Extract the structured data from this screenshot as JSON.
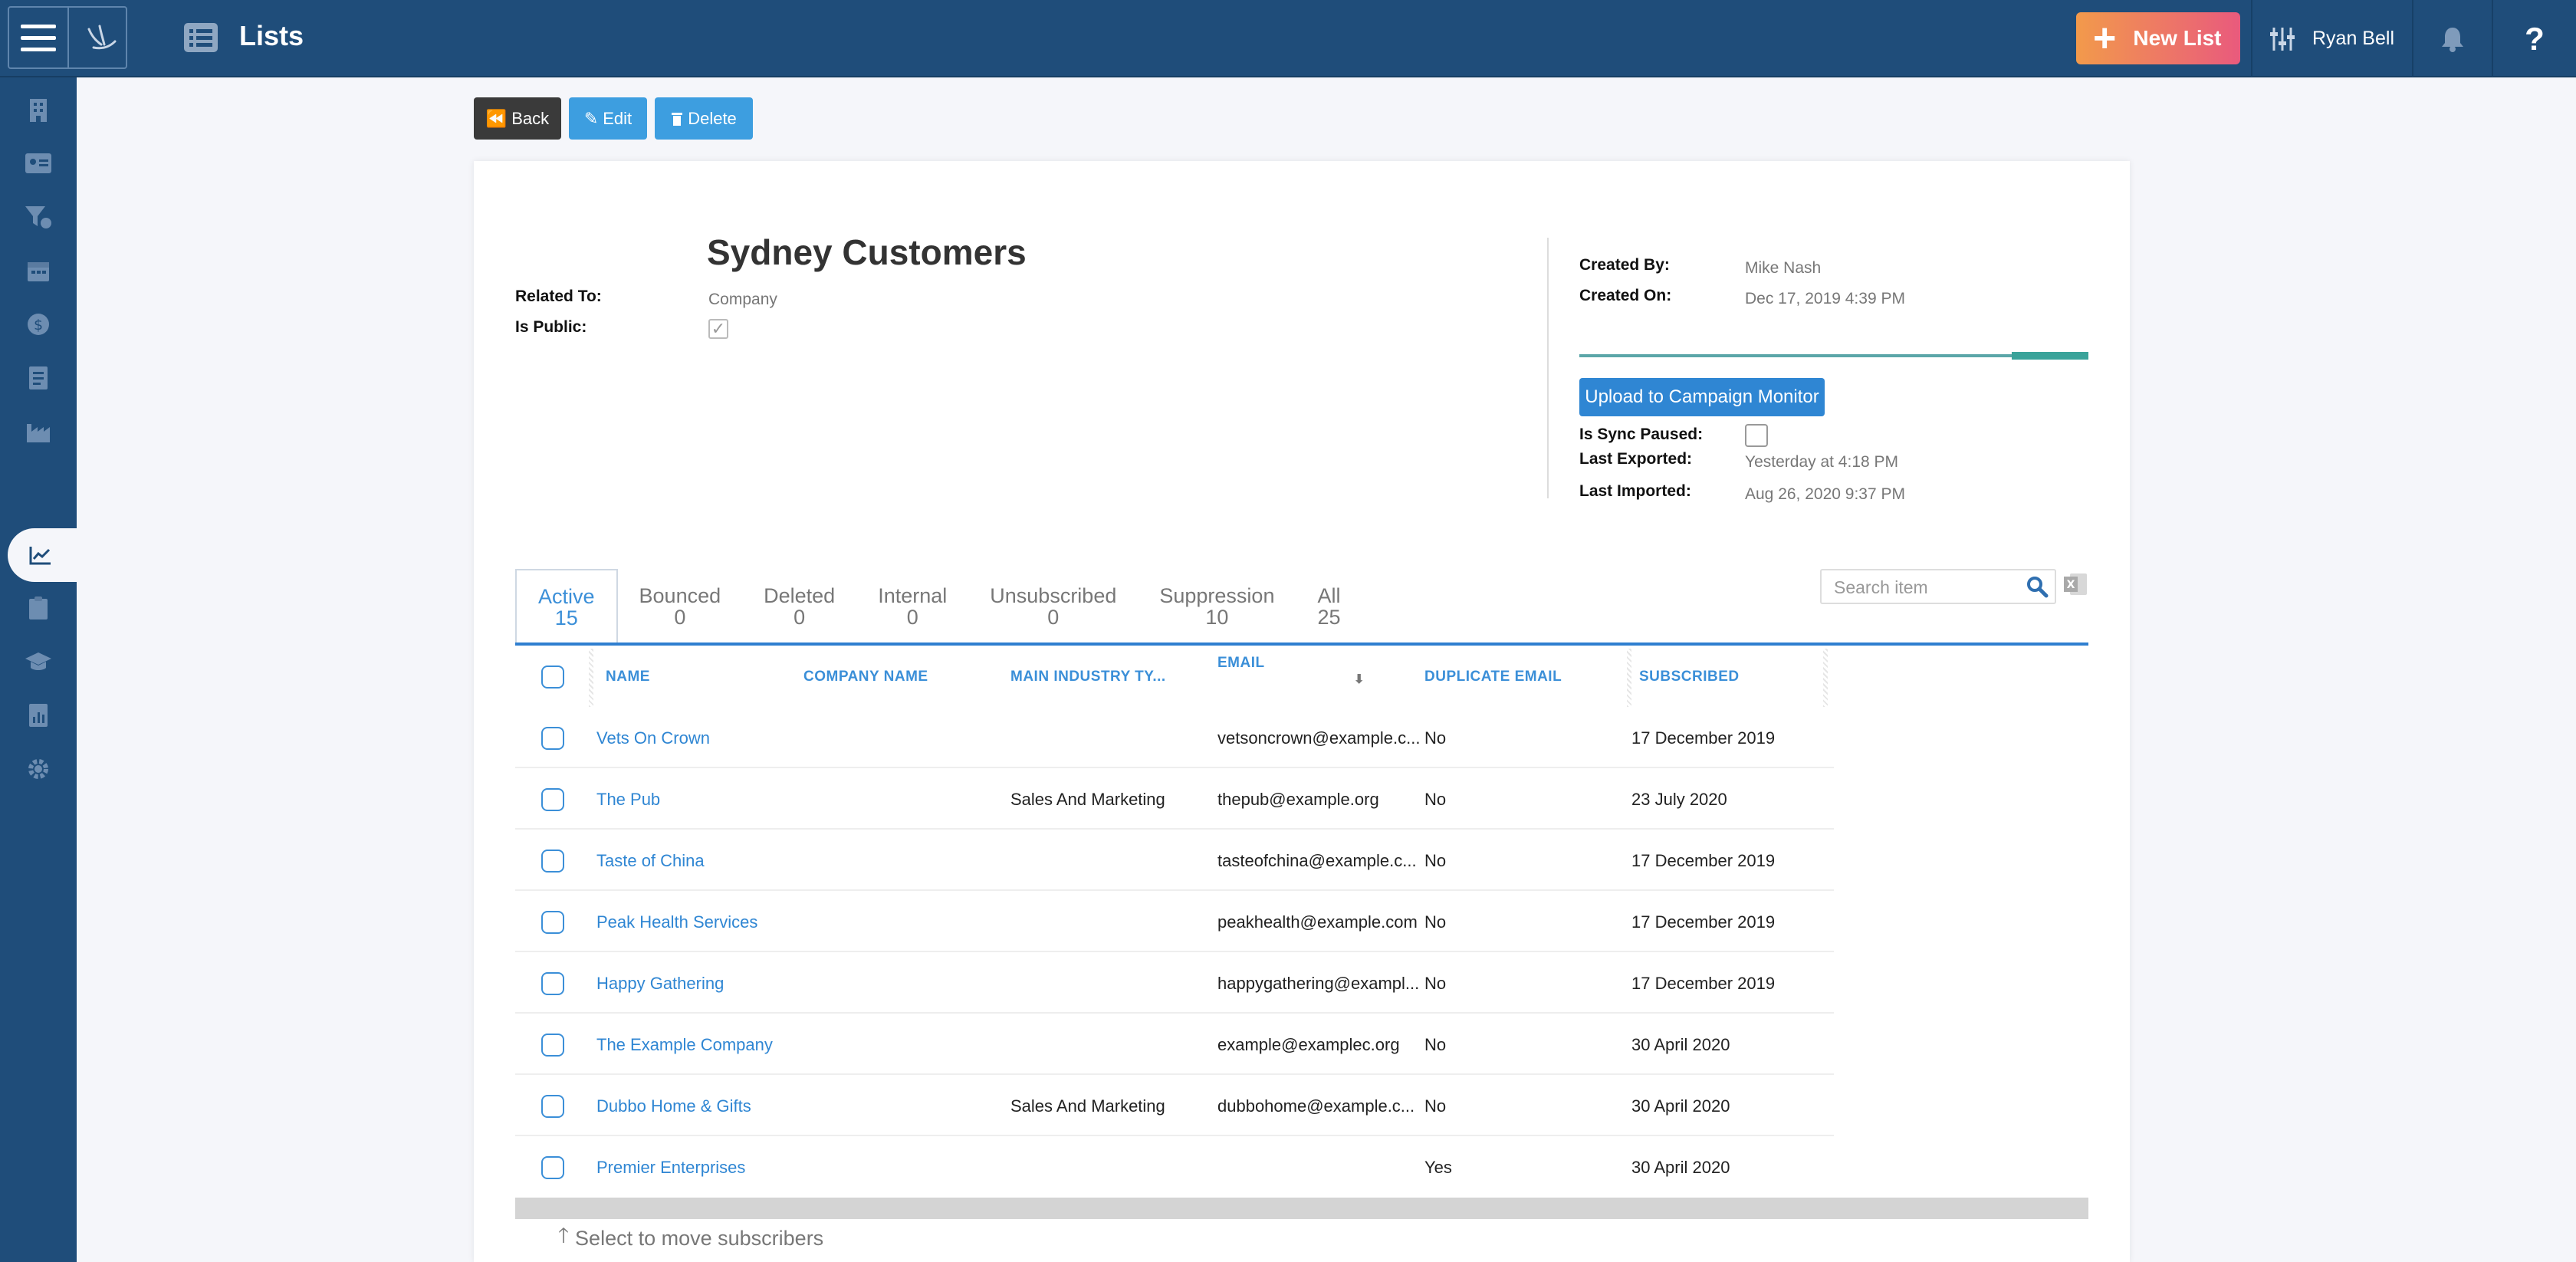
{
  "header": {
    "title": "Lists",
    "new_list_label": "New List",
    "user_name": "Ryan Bell",
    "help_label": "?"
  },
  "actions": {
    "back_label": "Back",
    "edit_label": "Edit",
    "delete_label": "Delete"
  },
  "record": {
    "title": "Sydney Customers",
    "related_to_label": "Related To:",
    "related_to_value": "Company",
    "is_public_label": "Is Public:",
    "is_public": true,
    "created_by_label": "Created By:",
    "created_by_value": "Mike Nash",
    "created_on_label": "Created On:",
    "created_on_value": "Dec 17, 2019 4:39 PM",
    "sync_progress": 0.15,
    "upload_button_label": "Upload to Campaign Monitor",
    "sync_paused_label": "Is Sync Paused:",
    "sync_paused": false,
    "last_exported_label": "Last Exported:",
    "last_exported_value": "Yesterday at 4:18 PM",
    "last_imported_label": "Last Imported:",
    "last_imported_value": "Aug 26, 2020 9:37 PM"
  },
  "tabs": [
    {
      "label": "Active",
      "count": "15"
    },
    {
      "label": "Bounced",
      "count": "0"
    },
    {
      "label": "Deleted",
      "count": "0"
    },
    {
      "label": "Internal",
      "count": "0"
    },
    {
      "label": "Unsubscribed",
      "count": "0"
    },
    {
      "label": "Suppression",
      "count": "10"
    },
    {
      "label": "All",
      "count": "25"
    }
  ],
  "search": {
    "placeholder": "Search item"
  },
  "table": {
    "columns": {
      "name": "NAME",
      "company": "COMPANY NAME",
      "industry": "MAIN INDUSTRY TY...",
      "email": "EMAIL",
      "duplicate": "DUPLICATE EMAIL",
      "subscribed": "SUBSCRIBED"
    },
    "rows": [
      {
        "name": "Vets On Crown",
        "company": "",
        "industry": "",
        "email": "vetsoncrown@example.c...",
        "duplicate": "No",
        "subscribed": "17 December 2019"
      },
      {
        "name": "The Pub",
        "company": "",
        "industry": "Sales And Marketing",
        "email": "thepub@example.org",
        "duplicate": "No",
        "subscribed": "23 July 2020"
      },
      {
        "name": "Taste of China",
        "company": "",
        "industry": "",
        "email": "tasteofchina@example.c...",
        "duplicate": "No",
        "subscribed": "17 December 2019"
      },
      {
        "name": "Peak Health Services",
        "company": "",
        "industry": "",
        "email": "peakhealth@example.com",
        "duplicate": "No",
        "subscribed": "17 December 2019"
      },
      {
        "name": "Happy Gathering",
        "company": "",
        "industry": "",
        "email": "happygathering@exampl...",
        "duplicate": "No",
        "subscribed": "17 December 2019"
      },
      {
        "name": "The Example Company",
        "company": "",
        "industry": "",
        "email": "example@examplec.org",
        "duplicate": "No",
        "subscribed": "30 April 2020"
      },
      {
        "name": "Dubbo Home & Gifts",
        "company": "",
        "industry": "Sales And Marketing",
        "email": "dubbohome@example.c...",
        "duplicate": "No",
        "subscribed": "30 April 2020"
      },
      {
        "name": "Premier Enterprises",
        "company": "",
        "industry": "",
        "email": "",
        "duplicate": "Yes",
        "subscribed": "30 April 2020"
      }
    ]
  },
  "footer_hint": "Select to move subscribers",
  "colors": {
    "header_bg": "#1f4d7a",
    "accent_blue": "#3d9ee0",
    "link_blue": "#2f86d3",
    "new_list_gradient_start": "#f29a4b",
    "new_list_gradient_end": "#e95a7d",
    "sync_bar": "#3aa39a"
  }
}
